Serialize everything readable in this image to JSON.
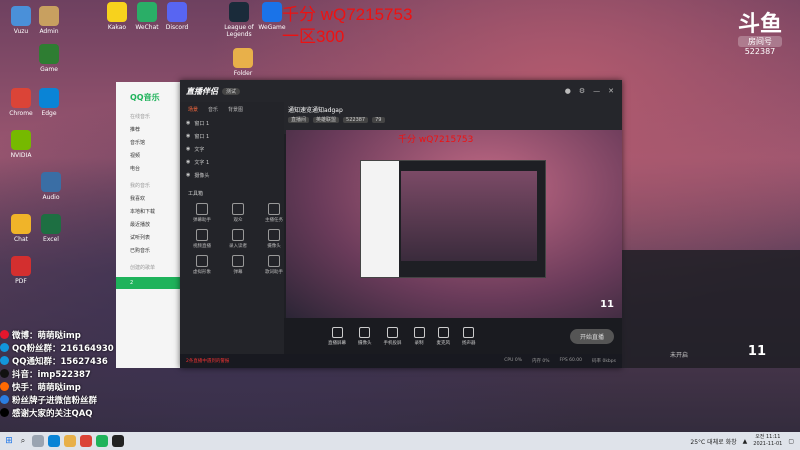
{
  "desktop": {
    "icons": [
      {
        "label": "Vuzu",
        "color": "#4a90d9"
      },
      {
        "label": "Admin",
        "color": "#c8a060"
      },
      {
        "label": "Kakao",
        "color": "#f7d21d"
      },
      {
        "label": "WeChat",
        "color": "#2aae67"
      },
      {
        "label": "Discord",
        "color": "#5865f2"
      },
      {
        "label": "League of Legends",
        "color": "#1a2b3a"
      },
      {
        "label": "WeGame",
        "color": "#1a73e8"
      },
      {
        "label": "Folder",
        "color": "#e8b04a"
      },
      {
        "label": "Chrome",
        "color": "#db4437"
      },
      {
        "label": "Edge",
        "color": "#0a84d6"
      },
      {
        "label": "NVIDIA",
        "color": "#76b900"
      },
      {
        "label": "Game",
        "color": "#2e7d32"
      },
      {
        "label": "Audio",
        "color": "#3a6ea5"
      },
      {
        "label": "Excel",
        "color": "#1d6f42"
      },
      {
        "label": "Chat",
        "color": "#f0b429"
      },
      {
        "label": "PDF",
        "color": "#d32f2f"
      }
    ],
    "overlay_line1": "千分 wQ7215753",
    "overlay_line2": "一区300"
  },
  "room_badge": {
    "logo": "斗鱼",
    "label": "房间号",
    "number": "522387"
  },
  "qq_music": {
    "brand": "QQ音乐",
    "online_section": "在线音乐",
    "online_items": [
      "推荐",
      "音乐馆",
      "视频",
      "电台"
    ],
    "mine_section": "我的音乐",
    "mine_items": [
      "我喜欢",
      "本地和下载",
      "最近播放",
      "试听列表",
      "已购音乐"
    ],
    "created_section": "创建的歌单",
    "active_item": "2"
  },
  "app": {
    "title": "直播伴侣",
    "version": "测试",
    "tabs": [
      "场景",
      "音乐",
      "背景图"
    ],
    "active_tab": "场景",
    "scenes": [
      "窗口 1",
      "窗口 1",
      "文字",
      "文字 1",
      "摄像头"
    ],
    "tools_title": "工具箱",
    "tools": [
      "弹幕助手",
      "观众",
      "主播任务",
      "视频直播",
      "录入读者",
      "摄像头",
      "虚拟形象",
      "弹幕",
      "歌词助手"
    ],
    "room_title": "通知速览通知adgap",
    "room_tags": [
      "直播间",
      "英雄联盟",
      "522387",
      "79"
    ],
    "start_button": "开始直播",
    "controls": [
      "直播屏幕",
      "摄像头",
      "手机投屏",
      "录制",
      "麦克风",
      "扬声器"
    ],
    "status_warn": "2条直播中遇到的警报",
    "status_items": [
      "CPU 0%",
      "内存 0%",
      "FPS 60.00",
      "码率 0kbps"
    ],
    "inner_count": "11"
  },
  "outer_panel": {
    "label": "未开启",
    "count": "11"
  },
  "contact": [
    {
      "label": "微博：萌萌哒imp",
      "color": "#e6162d"
    },
    {
      "label": "QQ粉丝群：216164930",
      "color": "#1296db"
    },
    {
      "label": "QQ通知群：15627436",
      "color": "#1296db"
    },
    {
      "label": "抖音：imp522387",
      "color": "#111111"
    },
    {
      "label": "快手：萌萌哒imp",
      "color": "#ff6a00"
    },
    {
      "label": "粉丝牌子进微信粉丝群",
      "color": "#2a7de1"
    },
    {
      "label": "感谢大家的关注QAQ",
      "color": "#000000"
    }
  ],
  "taskbar": {
    "weather": "25°C 대체로 화창",
    "time": "오전 11:11",
    "date": "2021-11-01"
  }
}
